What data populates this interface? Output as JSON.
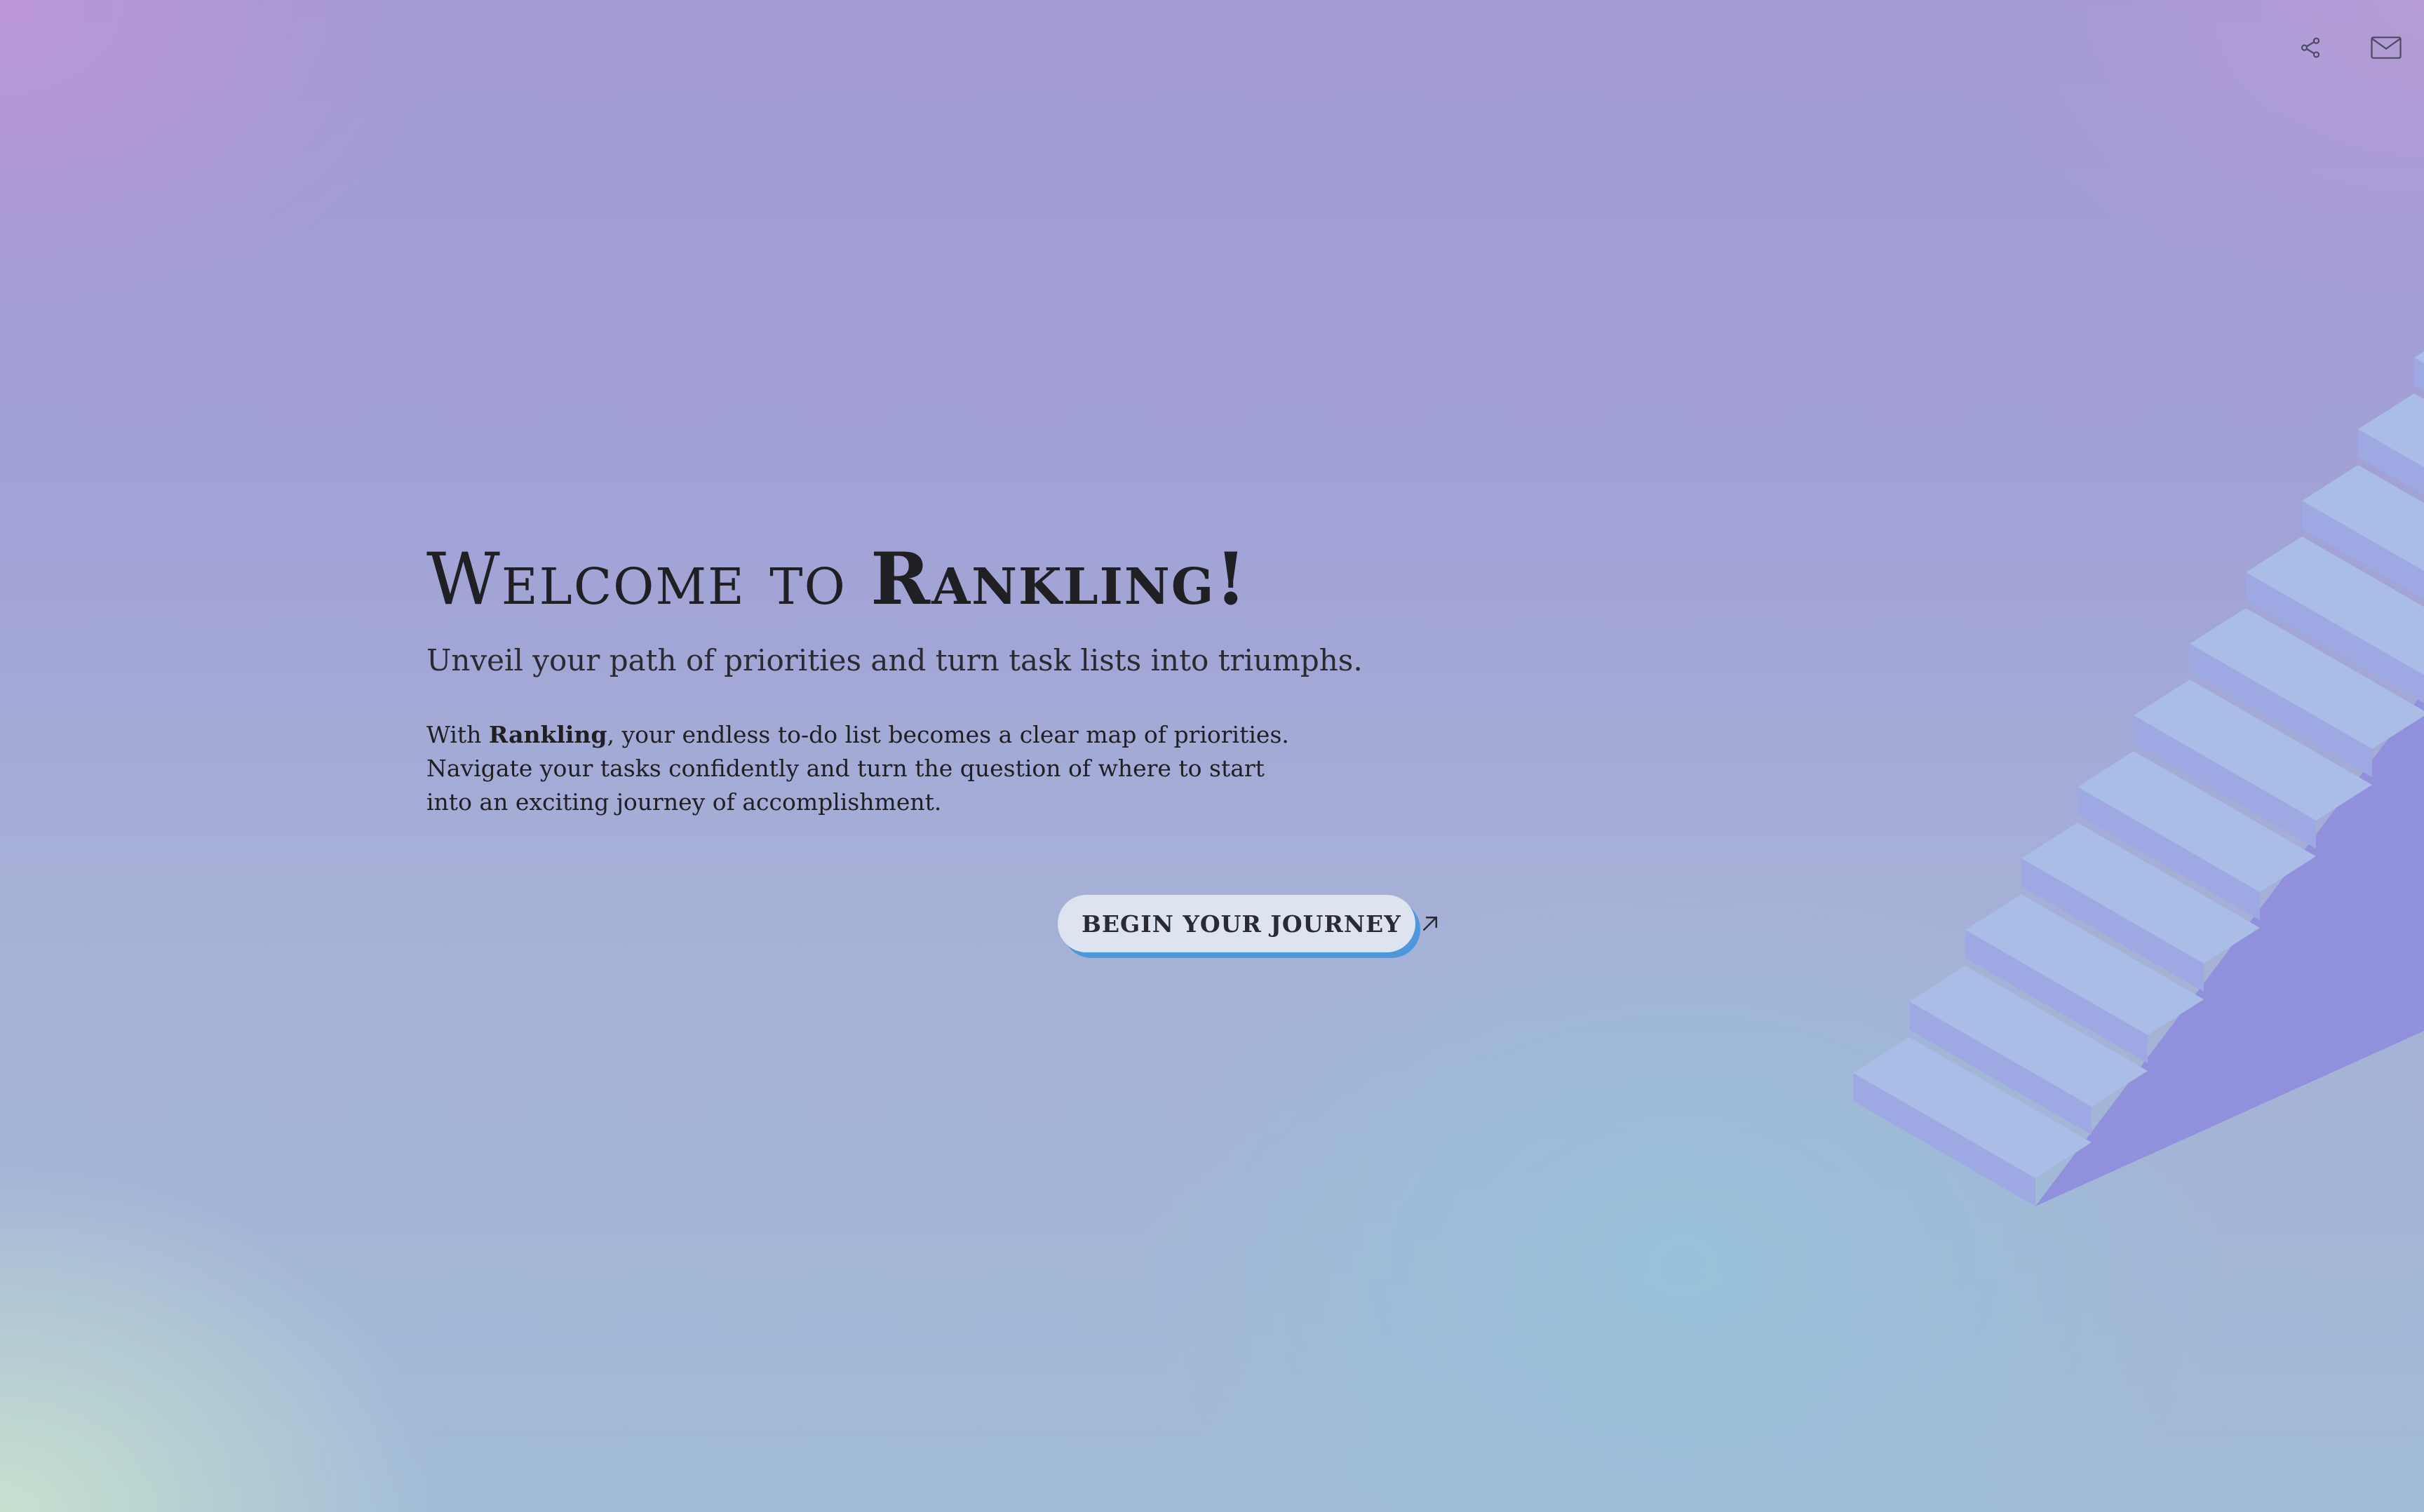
{
  "header": {
    "icons": [
      {
        "name": "share-icon"
      },
      {
        "name": "mail-icon"
      }
    ]
  },
  "hero": {
    "title_prefix": "Welcome to ",
    "title_brand": "Rankling!",
    "subtitle": "Unveil your path of priorities and turn task lists into triumphs.",
    "body_prefix": "With ",
    "body_brand": "Rankling",
    "body_rest": ", your endless to-do list becomes a clear map of priorities. Navigate your tasks confidently and turn the question of where to start into an exciting journey of accomplishment."
  },
  "cta": {
    "label": "BEGIN YOUR JOURNEY",
    "icon": "arrow-up-right-icon",
    "shadow_color": "#4d97dc"
  },
  "colors": {
    "stair_top": "#a9bde6",
    "stair_front": "#9ea8e2",
    "stair_side": "#9090dc"
  }
}
